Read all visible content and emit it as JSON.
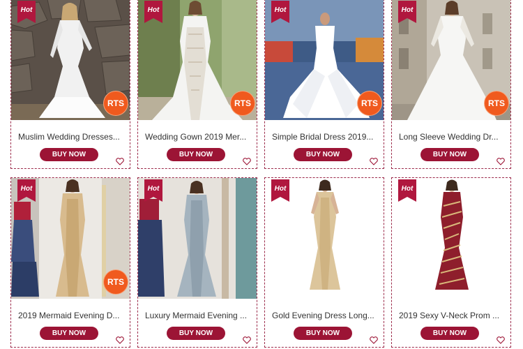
{
  "badges": {
    "hot_label": "Hot",
    "rts_label": "RTS",
    "buy_label": "BUY NOW",
    "wishlist_icon": "heart-outline-icon"
  },
  "colors": {
    "accent": "#9c1435",
    "hot_badge": "#b0173e",
    "rts_badge": "#f05a1e",
    "card_border": "#9c2a4a"
  },
  "products": [
    {
      "title": "Muslim Wedding Dresses...",
      "hot": true,
      "rts": true
    },
    {
      "title": "Wedding Gown 2019 Mer...",
      "hot": true,
      "rts": true
    },
    {
      "title": "Simple Bridal Dress 2019...",
      "hot": true,
      "rts": true
    },
    {
      "title": "Long Sleeve Wedding Dr...",
      "hot": true,
      "rts": true
    },
    {
      "title": "2019 Mermaid Evening D...",
      "hot": true,
      "rts": true
    },
    {
      "title": "Luxury Mermaid Evening ...",
      "hot": true,
      "rts": false
    },
    {
      "title": "Gold Evening Dress Long...",
      "hot": true,
      "rts": false
    },
    {
      "title": "2019 Sexy V-Neck Prom ...",
      "hot": true,
      "rts": false
    }
  ]
}
